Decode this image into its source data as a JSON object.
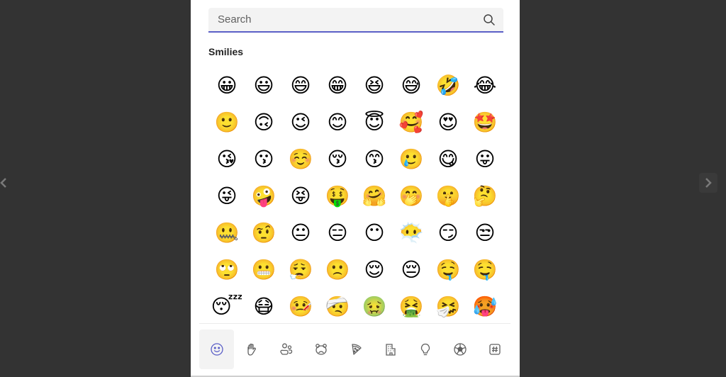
{
  "navigation": {
    "prev_icon": "chevron-left-icon",
    "next_icon": "chevron-right-icon"
  },
  "search": {
    "placeholder": "Search",
    "value": "",
    "icon": "search-icon",
    "accent_color": "#5b5fc7"
  },
  "section": {
    "title": "Smilies"
  },
  "emojis": [
    "😀",
    "😃",
    "😄",
    "😁",
    "😆",
    "😅",
    "🤣",
    "😂",
    "🙂",
    "🙃",
    "😉",
    "😊",
    "😇",
    "🥰",
    "😍",
    "🤩",
    "😘",
    "😗",
    "☺️",
    "😚",
    "😙",
    "🥲",
    "😋",
    "😛",
    "😜",
    "🤪",
    "😝",
    "🤑",
    "🤗",
    "🤭",
    "🤫",
    "🤔",
    "🤐",
    "🤨",
    "😐",
    "😑",
    "😶",
    "😶‍🌫️",
    "😏",
    "😒",
    "🙄",
    "😬",
    "😮‍💨",
    "🙁",
    "😌",
    "😔",
    "🤤",
    "🤤",
    "😴",
    "😷",
    "🤒",
    "🤕",
    "🤢",
    "🤮",
    "🤧",
    "🥵"
  ],
  "tabs": [
    {
      "name": "smilies",
      "icon": "smiley-icon",
      "active": true
    },
    {
      "name": "hand-gestures",
      "icon": "hand-icon",
      "active": false
    },
    {
      "name": "people",
      "icon": "people-icon",
      "active": false
    },
    {
      "name": "animals",
      "icon": "bear-icon",
      "active": false
    },
    {
      "name": "food",
      "icon": "pizza-icon",
      "active": false
    },
    {
      "name": "travel-places",
      "icon": "building-icon",
      "active": false
    },
    {
      "name": "objects",
      "icon": "lightbulb-icon",
      "active": false
    },
    {
      "name": "activities",
      "icon": "soccer-ball-icon",
      "active": false
    },
    {
      "name": "symbols",
      "icon": "hashtag-icon",
      "active": false
    }
  ]
}
